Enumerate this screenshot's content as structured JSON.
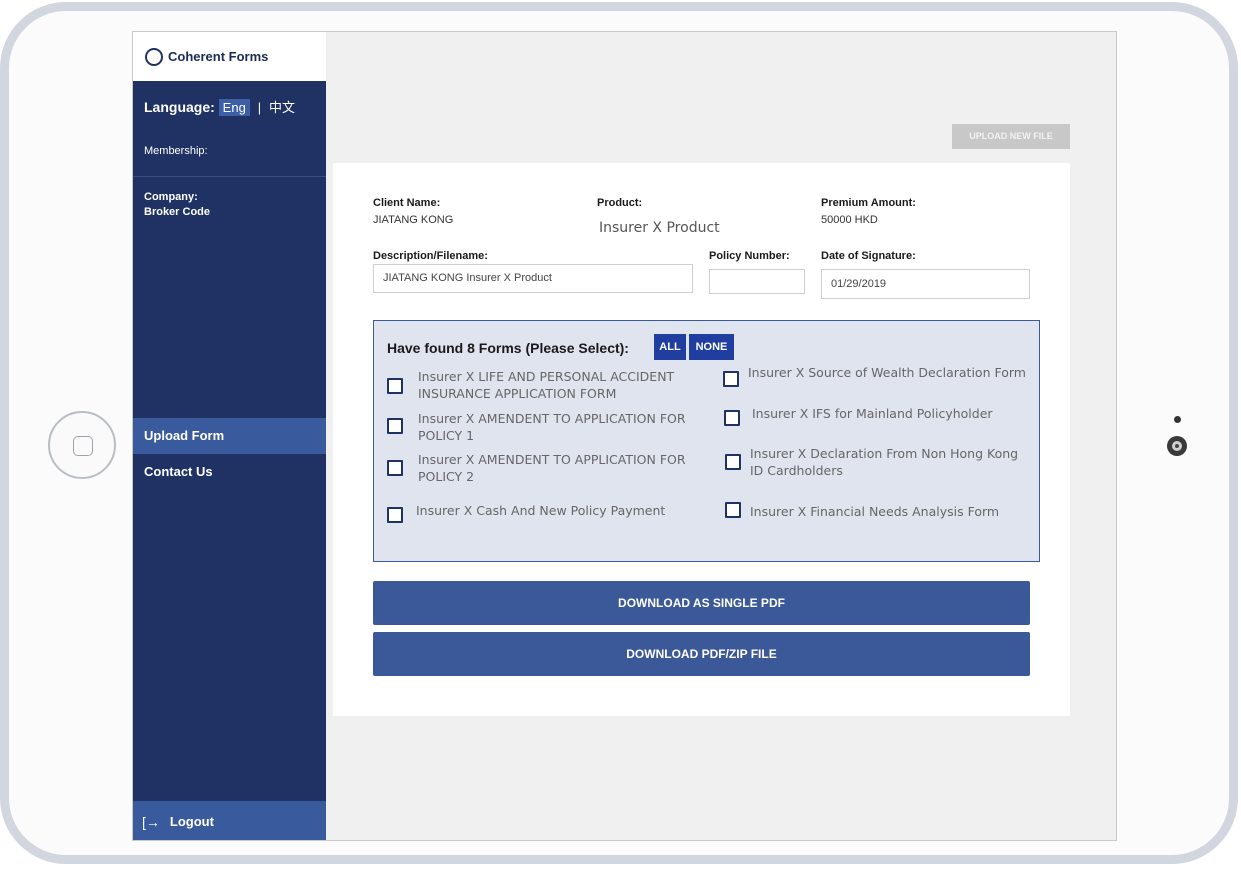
{
  "app": {
    "brand": "Coherent Forms"
  },
  "sidebar": {
    "language_label": "Language:",
    "language_active": "Eng",
    "language_separator": "|",
    "language_other": "中文",
    "membership_label": "Membership:",
    "company_label": "Company:",
    "broker_code_label": "Broker Code",
    "nav": [
      {
        "label": "Upload Form",
        "active": true
      },
      {
        "label": "Contact Us",
        "active": false
      }
    ],
    "logout_icon": "logout-arrow-icon",
    "logout_label": "Logout"
  },
  "header": {
    "upload_button": "UPLOAD NEW FILE"
  },
  "details": {
    "client_name_label": "Client Name:",
    "client_name": "JIATANG KONG",
    "product_label": "Product:",
    "product": "Insurer X Product",
    "premium_label": "Premium Amount:",
    "premium": "50000 HKD",
    "description_label": "Description/Filename:",
    "description_value": "JIATANG KONG Insurer X Product",
    "policy_number_label": "Policy Number:",
    "policy_number_value": "",
    "date_label": "Date of Signature:",
    "date_value": "01/29/2019"
  },
  "forms": {
    "title": "Have found 8 Forms (Please Select):",
    "all_label": "ALL",
    "none_label": "NONE",
    "items": [
      {
        "label": "Insurer X LIFE AND PERSONAL ACCIDENT INSURANCE APPLICATION FORM",
        "checked": false
      },
      {
        "label": "Insurer X Source of Wealth Declaration Form",
        "checked": false
      },
      {
        "label": "Insurer X AMENDENT TO APPLICATION FOR POLICY 1",
        "checked": false
      },
      {
        "label": "Insurer X IFS for Mainland Policyholder",
        "checked": false
      },
      {
        "label": "Insurer X AMENDENT TO APPLICATION FOR POLICY 2",
        "checked": false
      },
      {
        "label": "Insurer X Declaration From Non Hong Kong ID Cardholders",
        "checked": false
      },
      {
        "label": "Insurer X Cash And New Policy Payment",
        "checked": false
      },
      {
        "label": "Insurer X Financial Needs Analysis Form",
        "checked": false
      }
    ]
  },
  "actions": {
    "download_single": "DOWNLOAD AS SINGLE PDF",
    "download_zip": "DOWNLOAD PDF/ZIP FILE"
  },
  "colors": {
    "sidebar": "#1f3263",
    "accent": "#3b5998",
    "active_nav": "#3a5a9e"
  }
}
